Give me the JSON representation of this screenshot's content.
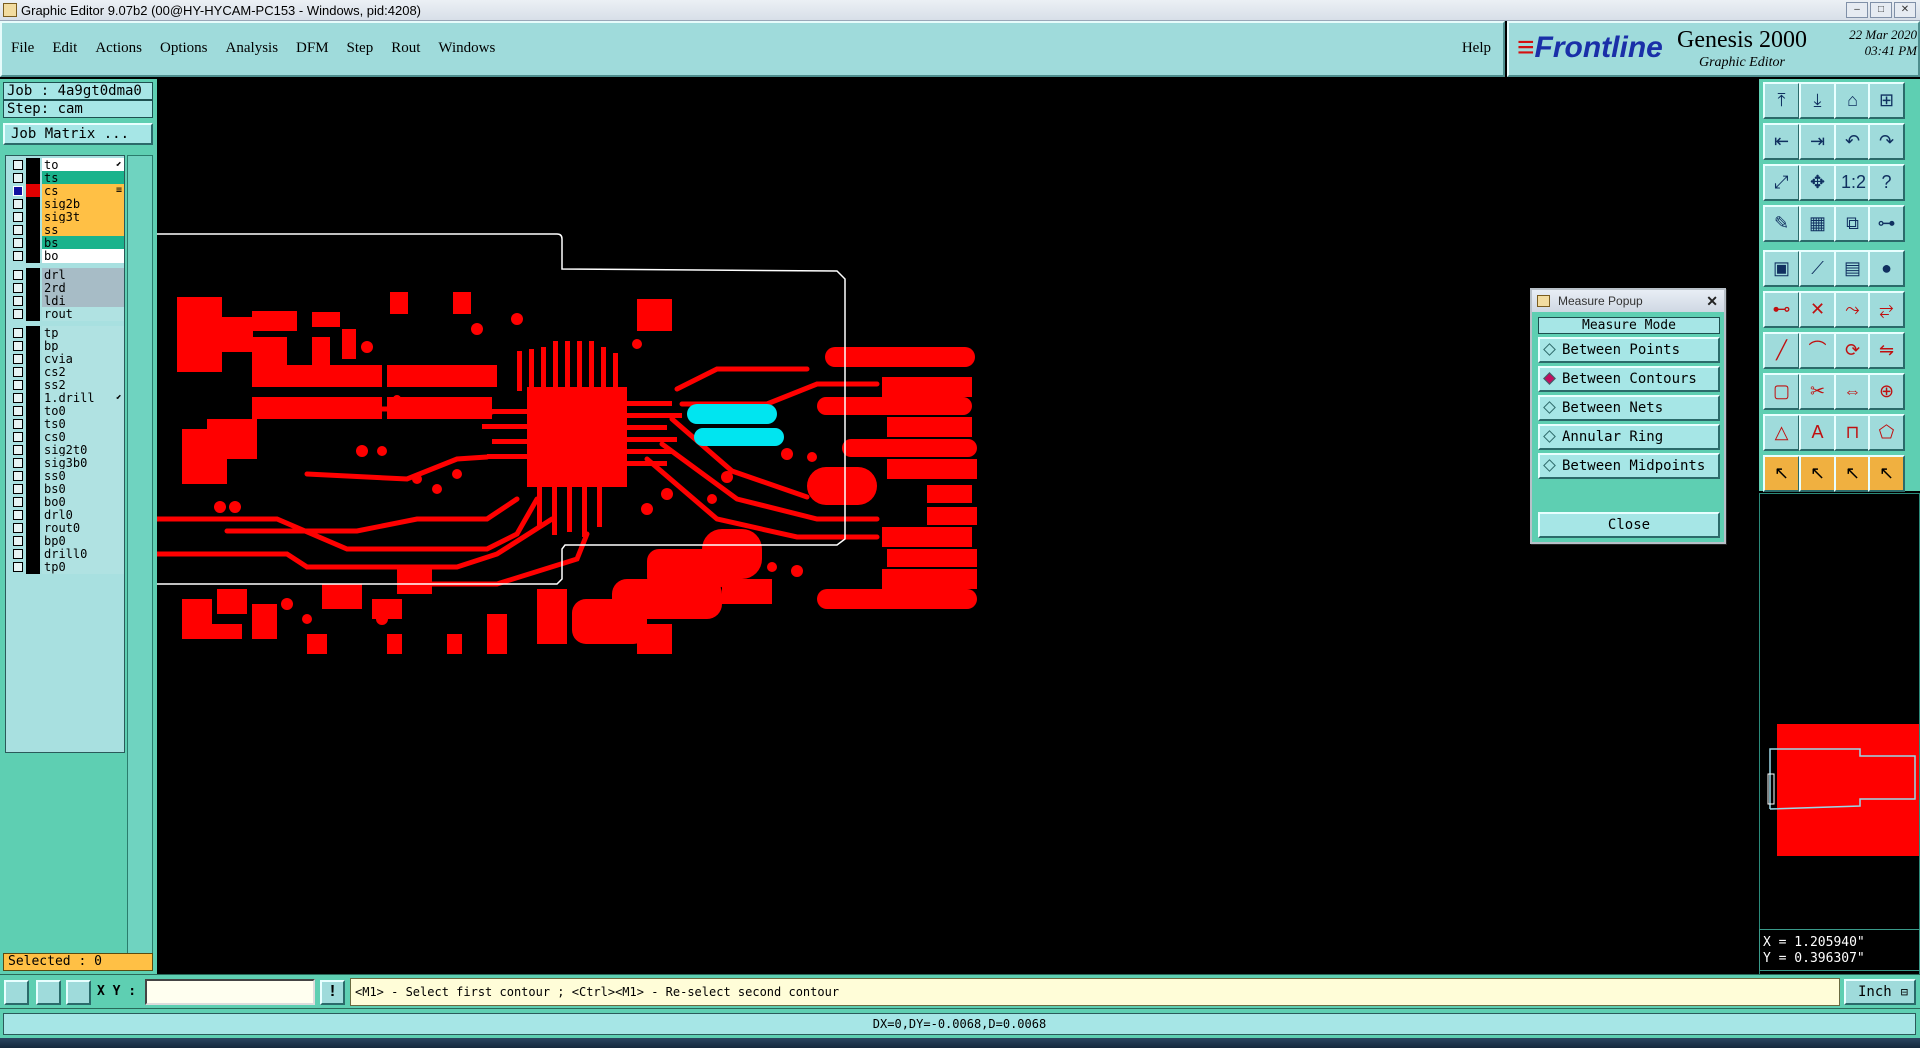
{
  "window": {
    "title": "Graphic Editor 9.07b2 (00@HY-HYCAM-PC153 - Windows, pid:4208)",
    "buttons": [
      "–",
      "□",
      "✕"
    ]
  },
  "menu": {
    "items": [
      "File",
      "Edit",
      "Actions",
      "Options",
      "Analysis",
      "DFM",
      "Step",
      "Rout",
      "Windows"
    ],
    "help": "Help"
  },
  "brand": {
    "logo": "Frontline",
    "product": "Genesis 2000",
    "subtitle": "Graphic Editor",
    "date": "22 Mar 2020",
    "time": "03:41 PM"
  },
  "left_panel": {
    "job": "Job : 4a9gt0dma0",
    "step": "Step: cam",
    "job_matrix": "Job Matrix ...",
    "selected": "Selected : 0",
    "layers": [
      {
        "name": "to",
        "color": "white",
        "checked": false,
        "mark": "⬋"
      },
      {
        "name": "ts",
        "color": "green",
        "checked": false
      },
      {
        "name": "cs",
        "color": "orange",
        "checked": true,
        "active": true,
        "mark": "≡"
      },
      {
        "name": "sig2b",
        "color": "orange",
        "checked": false
      },
      {
        "name": "sig3t",
        "color": "orange",
        "checked": false
      },
      {
        "name": "ss",
        "color": "orange",
        "checked": false
      },
      {
        "name": "bs",
        "color": "green",
        "checked": false
      },
      {
        "name": "bo",
        "color": "white",
        "checked": false
      },
      {
        "name": "drl",
        "color": "grey",
        "checked": false,
        "gap": true
      },
      {
        "name": "2rd",
        "color": "grey",
        "checked": false
      },
      {
        "name": "ldi",
        "color": "grey",
        "checked": false
      },
      {
        "name": "rout",
        "color": "teal",
        "checked": false
      },
      {
        "name": "tp",
        "color": "teal",
        "checked": false,
        "gap": true
      },
      {
        "name": "bp",
        "color": "teal",
        "checked": false
      },
      {
        "name": "cvia",
        "color": "teal",
        "checked": false
      },
      {
        "name": "cs2",
        "color": "teal",
        "checked": false
      },
      {
        "name": "ss2",
        "color": "teal",
        "checked": false
      },
      {
        "name": "1.drill",
        "color": "teal",
        "checked": false,
        "mark": "⬋"
      },
      {
        "name": "to0",
        "color": "teal",
        "checked": false
      },
      {
        "name": "ts0",
        "color": "teal",
        "checked": false
      },
      {
        "name": "cs0",
        "color": "teal",
        "checked": false
      },
      {
        "name": "sig2t0",
        "color": "teal",
        "checked": false
      },
      {
        "name": "sig3b0",
        "color": "teal",
        "checked": false
      },
      {
        "name": "ss0",
        "color": "teal",
        "checked": false
      },
      {
        "name": "bs0",
        "color": "teal",
        "checked": false
      },
      {
        "name": "bo0",
        "color": "teal",
        "checked": false
      },
      {
        "name": "drl0",
        "color": "teal",
        "checked": false
      },
      {
        "name": "rout0",
        "color": "teal",
        "checked": false
      },
      {
        "name": "bp0",
        "color": "teal",
        "checked": false
      },
      {
        "name": "drill0",
        "color": "teal",
        "checked": false
      },
      {
        "name": "tp0",
        "color": "teal",
        "checked": false
      }
    ]
  },
  "measure_popup": {
    "title": "Measure Popup",
    "mode_label": "Measure Mode",
    "options": [
      {
        "label": "Between Points",
        "selected": false
      },
      {
        "label": "Between Contours",
        "selected": true
      },
      {
        "label": "Between Nets",
        "selected": false
      },
      {
        "label": "Annular Ring",
        "selected": false
      },
      {
        "label": "Between Midpoints",
        "selected": false
      }
    ],
    "close": "Close"
  },
  "coords": {
    "x": "X = 1.205940\"",
    "y": "Y = 0.396307\""
  },
  "command_bar": {
    "xy_label": "X Y :",
    "xy_value": "",
    "prompt": "<M1> - Select first contour ; <Ctrl><M1> - Re-select second contour",
    "unit": "Inch"
  },
  "status": {
    "text": "DX=0,DY=-0.0068,D=0.0068"
  },
  "colors": {
    "copper": "#ff0000",
    "highlight": "#00e5f0",
    "outline": "#ffffff",
    "panel": "#5ecfb2",
    "button": "#9fdbdb"
  }
}
